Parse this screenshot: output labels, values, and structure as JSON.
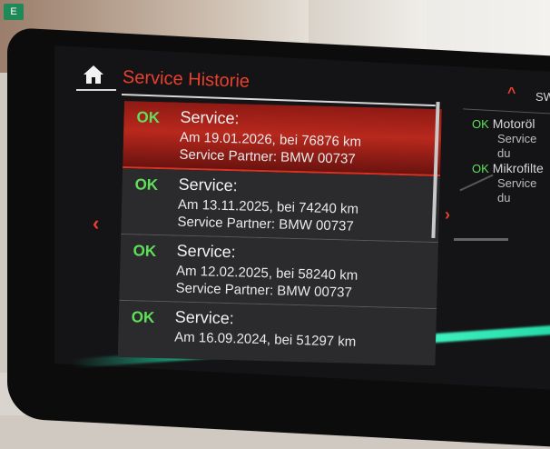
{
  "corner_badge": "E",
  "header": {
    "home_icon": "home-icon",
    "title": "Service Historie"
  },
  "list": {
    "items": [
      {
        "status": "OK",
        "title": "Service:",
        "date_line": "Am 19.01.2026, bei 76876 km",
        "partner": "Service Partner: BMW 00737",
        "selected": true
      },
      {
        "status": "OK",
        "title": "Service:",
        "date_line": "Am 13.11.2025, bei 74240 km",
        "partner": "Service Partner: BMW 00737",
        "selected": false
      },
      {
        "status": "OK",
        "title": "Service:",
        "date_line": "Am 12.02.2025, bei 58240 km",
        "partner": "Service Partner: BMW 00737",
        "selected": false
      },
      {
        "status": "OK",
        "title": "Service:",
        "date_line": "Am 16.09.2024, bei 51297 km",
        "partner": "",
        "selected": false
      }
    ]
  },
  "nav": {
    "left_arrow": "‹",
    "right_arrow": "›",
    "up_arrow": "^",
    "sw_label": "SW"
  },
  "side_panel": {
    "items": [
      {
        "status": "OK",
        "title": "Motoröl",
        "subtitle": "Service du"
      },
      {
        "status": "OK",
        "title": "Mikrofilte",
        "subtitle": "Service du"
      }
    ]
  },
  "colors": {
    "accent": "#e8402c",
    "ok": "#5fe05a",
    "selection": "#b8281d",
    "ambient": "#20d6a2"
  }
}
